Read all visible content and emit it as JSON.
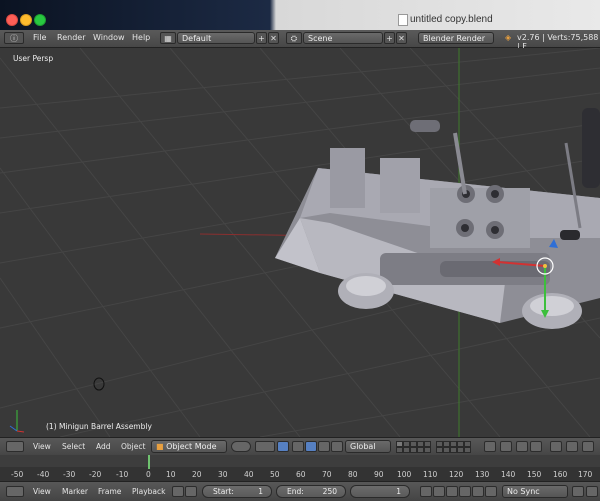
{
  "window": {
    "title": "untitled copy.blend"
  },
  "menu": {
    "items": [
      "File",
      "Render",
      "Window",
      "Help"
    ],
    "screen_layout": "Default",
    "scene": "Scene",
    "render_engine": "Blender Render",
    "version_stats": "v2.76 | Verts:75,588 | F"
  },
  "viewport": {
    "view_label": "User Persp",
    "object_label": "(1) Minigun Barrel Assembly"
  },
  "view3d_header": {
    "items": [
      "View",
      "Select",
      "Add",
      "Object"
    ],
    "mode": "Object Mode",
    "orientation": "Global"
  },
  "timeline": {
    "ruler": [
      "-50",
      "-40",
      "-30",
      "-20",
      "-10",
      "0",
      "10",
      "20",
      "30",
      "40",
      "50",
      "60",
      "70",
      "80",
      "90",
      "100",
      "110",
      "120",
      "130",
      "140",
      "150",
      "160",
      "170"
    ],
    "current_frame": "0"
  },
  "timeline_header": {
    "items": [
      "View",
      "Marker",
      "Frame",
      "Playback"
    ],
    "start_label": "Start:",
    "start_value": "1",
    "end_label": "End:",
    "end_value": "250",
    "current_value": "1",
    "sync": "No Sync"
  },
  "colors": {
    "axis_x": "#a83232",
    "axis_y": "#4c8a2a",
    "background": "#393939"
  }
}
